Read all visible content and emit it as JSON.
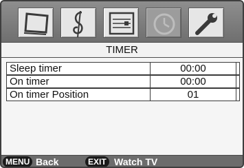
{
  "title": "TIMER",
  "icons": [
    {
      "name": "picture-icon"
    },
    {
      "name": "sound-icon"
    },
    {
      "name": "setup-icon"
    },
    {
      "name": "clock-icon",
      "active": true
    },
    {
      "name": "wrench-icon"
    }
  ],
  "rows": [
    {
      "label": "Sleep timer",
      "value": "00:00"
    },
    {
      "label": "On timer",
      "value": "00:00"
    },
    {
      "label": "On timer Position",
      "value": "01"
    }
  ],
  "footer": {
    "menu_key": "MENU",
    "menu_label": "Back",
    "exit_key": "EXIT",
    "exit_label": "Watch TV"
  }
}
